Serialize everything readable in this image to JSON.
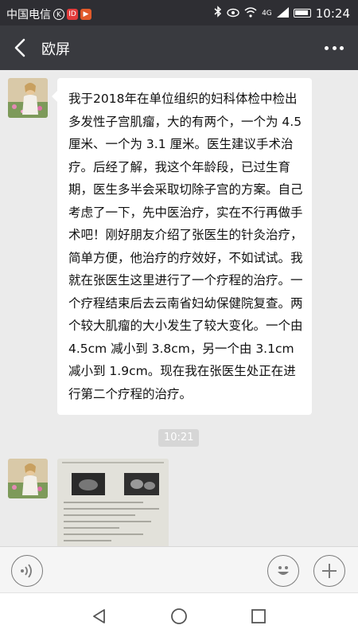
{
  "status_bar": {
    "carrier": "中国电信",
    "app_badge_1": "K",
    "app_badge_2": "ID",
    "app_badge_3": "▶",
    "network": "4G",
    "time": "10:24"
  },
  "header": {
    "title": "欧屏"
  },
  "messages": [
    {
      "type": "text",
      "text": "我于2018年在单位组织的妇科体检中检出多发性子宫肌瘤，大的有两个，一个为 4.5 厘米、一个为 3.1 厘米。医生建议手术治疗。后经了解，我这个年龄段，已过生育期，医生多半会采取切除子宫的方案。自己考虑了一下，先中医治疗，实在不行再做手术吧！刚好朋友介绍了张医生的针灸治疗，简单方便，他治疗的疗效好，不如试试。我就在张医生这里进行了一个疗程的治疗。一个疗程结束后去云南省妇幼保健院复查。两个较大肌瘤的大小发生了较大变化。一个由 4.5cm 减小到 3.8cm，另一个由 3.1cm 减小到 1.9cm。现在我在张医生处正在进行第二个疗程的治疗。"
    }
  ],
  "timestamp": "10:21",
  "colors": {
    "status_bg": "#2e2e33",
    "nav_bg": "#393a3f",
    "chat_bg": "#ebebeb",
    "bubble_bg": "#ffffff",
    "input_bg": "#f5f5f5"
  }
}
